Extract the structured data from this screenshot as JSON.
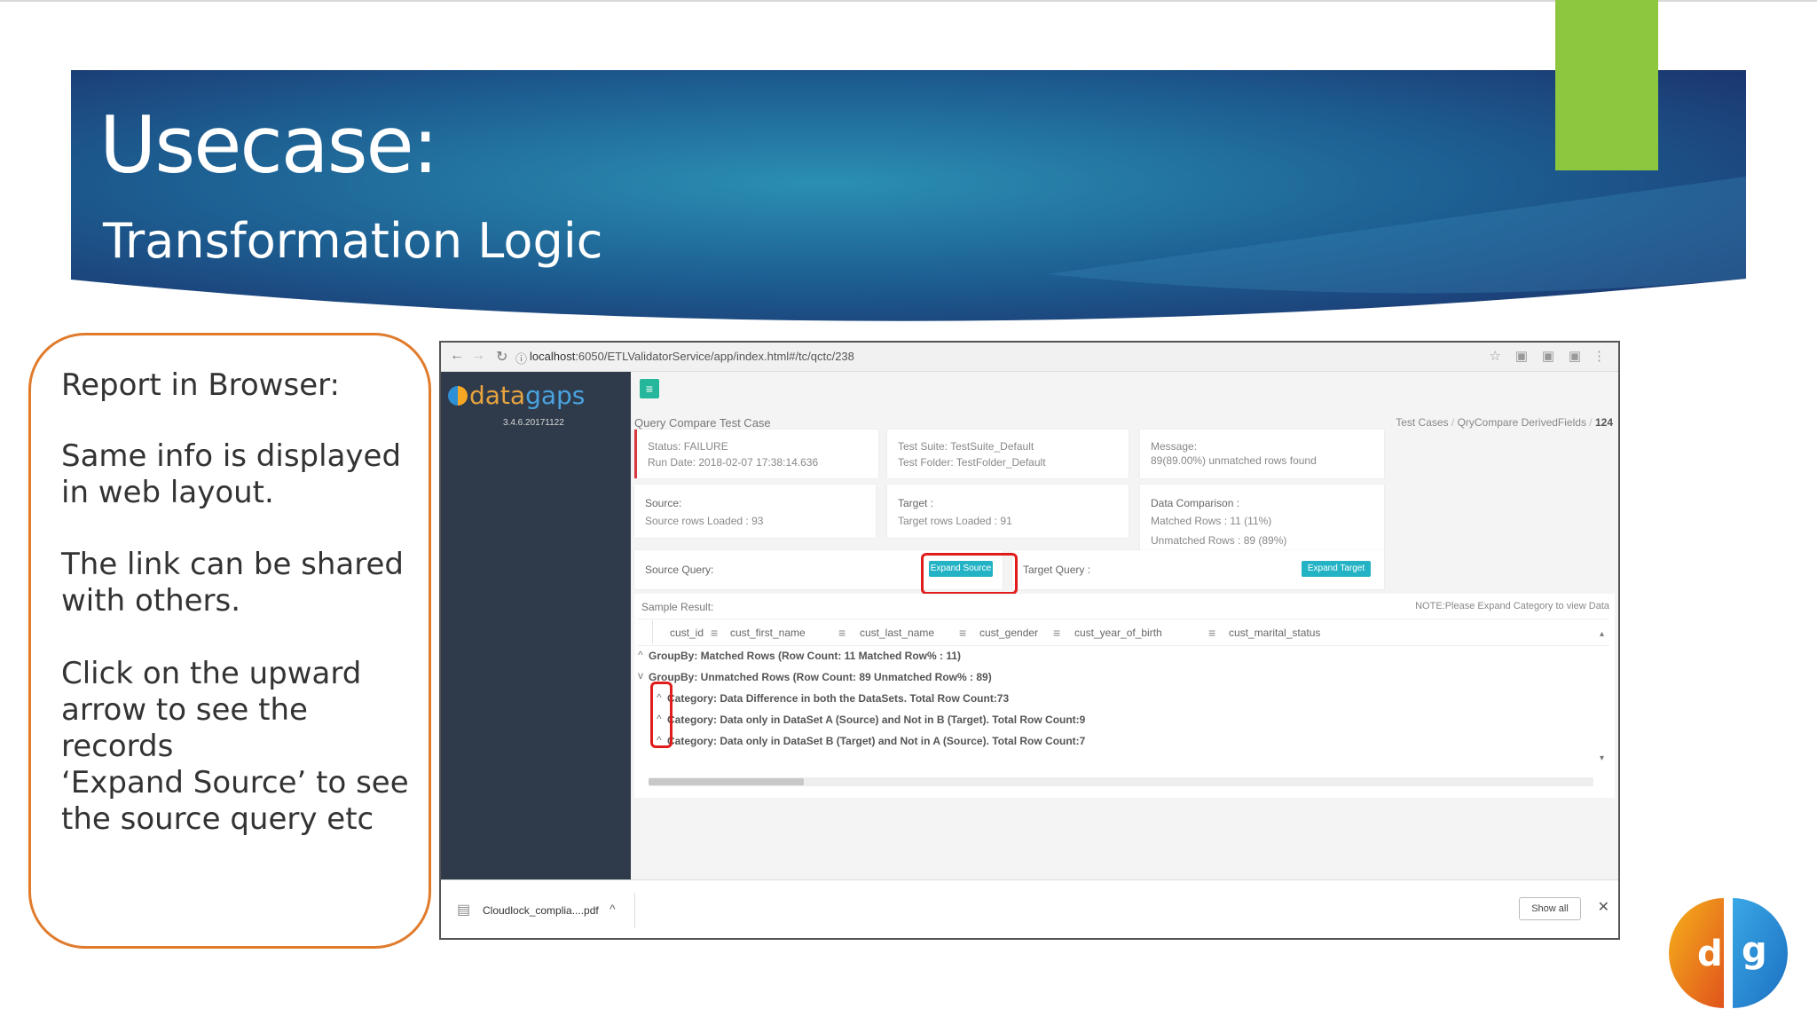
{
  "slide": {
    "title": "Usecase:",
    "subtitle": "Transformation Logic",
    "accent_color": "#8dc63f",
    "banner_colors": [
      "#1b3f7a",
      "#2a7fa6"
    ]
  },
  "callout": {
    "border_color": "#e07b2c",
    "paragraphs": [
      "Report in Browser:",
      "Same info is displayed in web layout.",
      "The link can be shared with others.",
      "Click on the upward arrow to see the records",
      "‘Expand Source’ to see the source query etc"
    ]
  },
  "browser": {
    "url_host": "localhost",
    "url_rest": ":6050/ETLValidatorService/app/index.html#/tc/qctc/238",
    "logo_text_a": "data",
    "logo_text_b": "gaps",
    "logo_version": "3.4.6.20171122",
    "page_title": "Query Compare Test Case",
    "breadcrumbs": {
      "a": "Test Cases",
      "b": "QryCompare DerivedFields",
      "c": "124"
    },
    "status_card": {
      "status": "Status: FAILURE",
      "run_date": "Run Date: 2018-02-07 17:38:14.636"
    },
    "suite_card": {
      "suite": "Test Suite: TestSuite_Default",
      "folder": "Test Folder: TestFolder_Default"
    },
    "message_card": {
      "label": "Message:",
      "text": "89(89.00%) unmatched rows found"
    },
    "source_card": {
      "label": "Source:",
      "rows": "Source rows Loaded : 93"
    },
    "target_card": {
      "label": "Target :",
      "rows": "Target rows Loaded : 91"
    },
    "comparison_card": {
      "label": "Data Comparison :",
      "matched": "Matched Rows : 11 (11%)",
      "unmatched": "Unmatched Rows : 89 (89%)"
    },
    "source_query": {
      "label": "Source Query:",
      "button": "Expand Source"
    },
    "target_query": {
      "label": "Target Query :",
      "button": "Expand Target"
    },
    "sample": {
      "label": "Sample Result:",
      "note": "NOTE:Please Expand Category to view Data",
      "columns": [
        "cust_id",
        "cust_first_name",
        "cust_last_name",
        "cust_gender",
        "cust_year_of_birth",
        "cust_marital_status"
      ],
      "groups": [
        "GroupBy: Matched Rows (Row Count: 11 Matched Row% : 11)",
        "GroupBy: Unmatched Rows (Row Count: 89 Unmatched Row% : 89)"
      ],
      "categories": [
        "Category: Data Difference in both the DataSets. Total Row Count:73",
        "Category: Data only in DataSet A (Source) and Not in B (Target). Total Row Count:9",
        "Category: Data only in DataSet B (Target) and Not in A (Source). Total Row Count:7"
      ]
    },
    "download": {
      "file": "Cloudlock_complia....pdf",
      "show_all": "Show all"
    },
    "accent_teal": "#24b3c5",
    "highlight_color": "#e01d1d"
  }
}
